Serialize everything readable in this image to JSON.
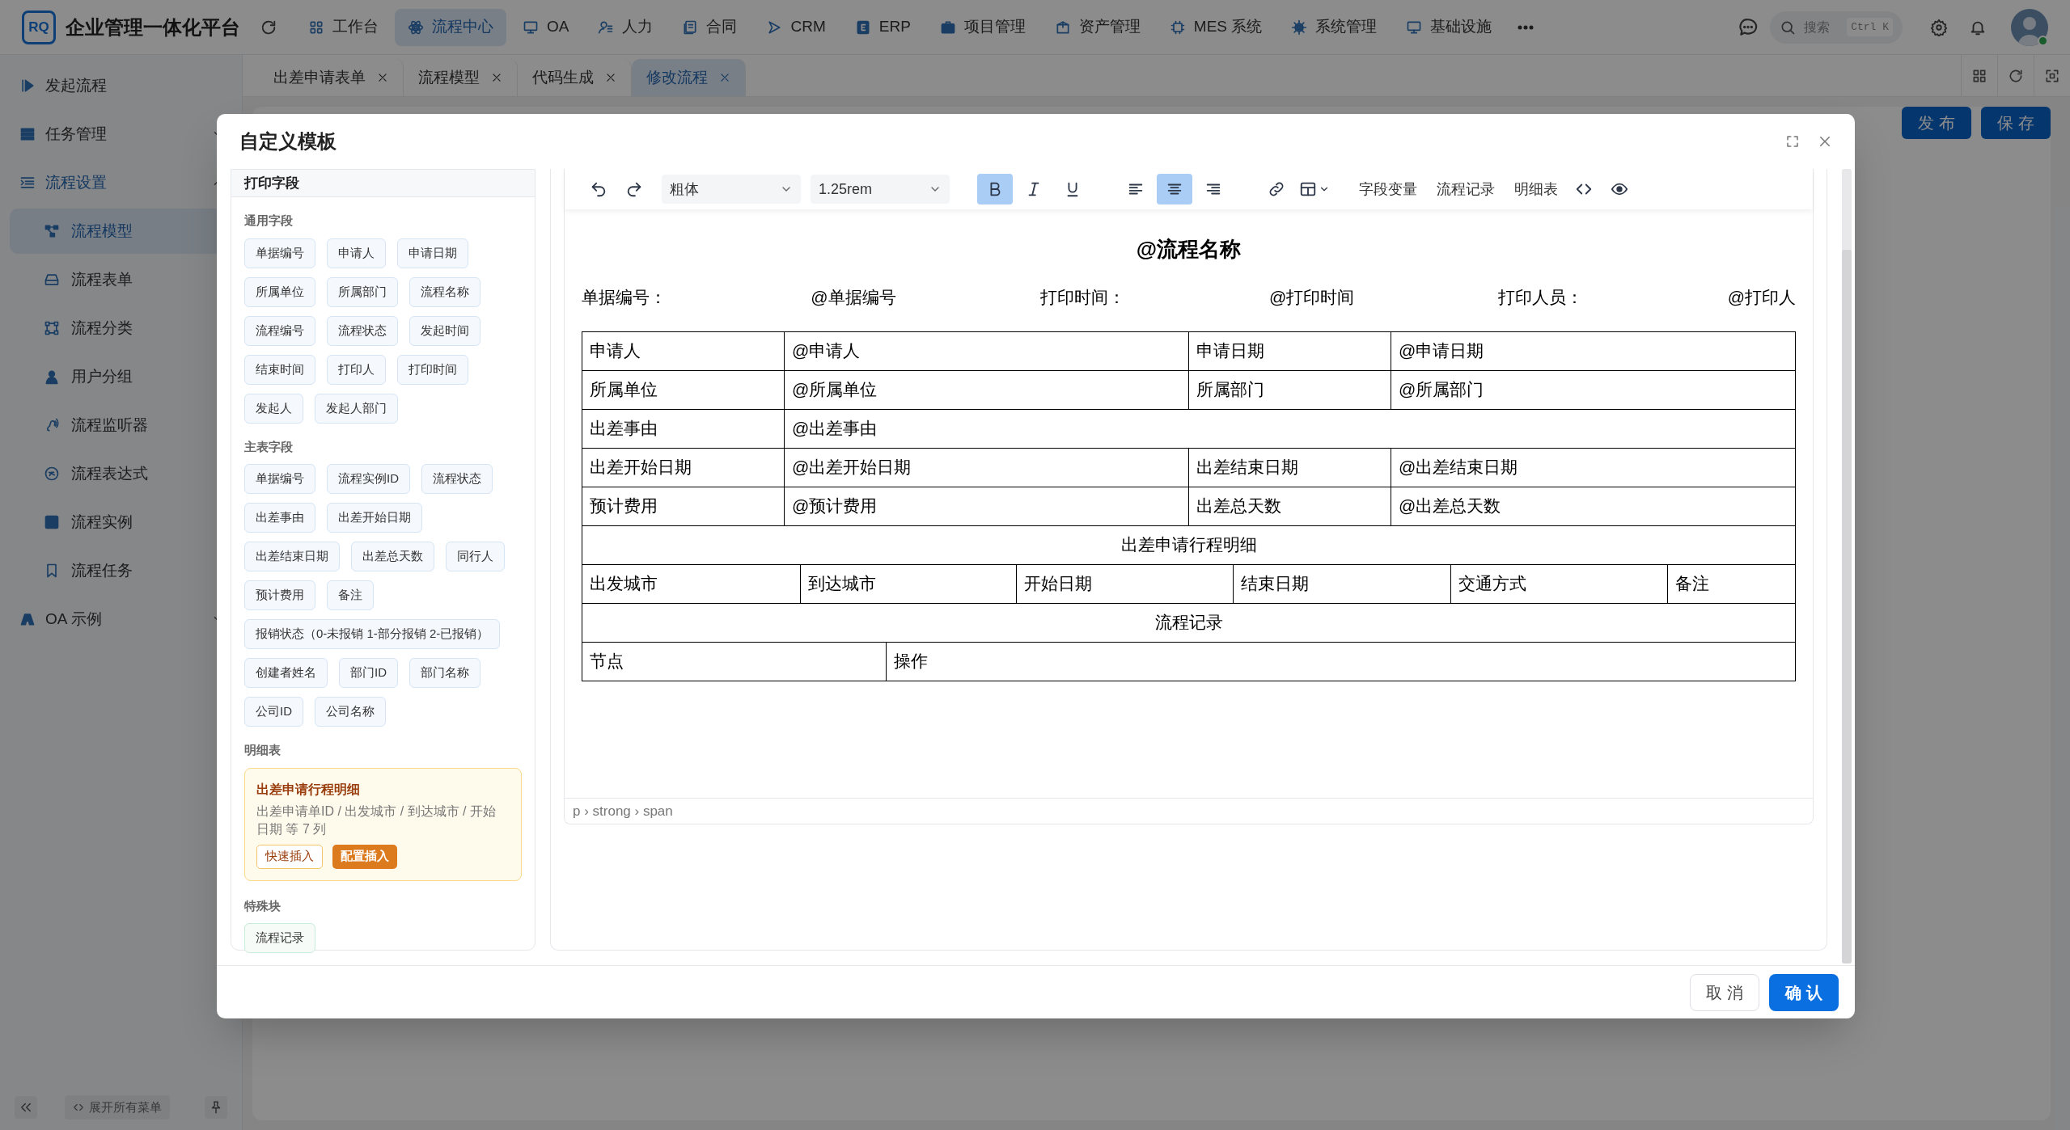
{
  "app": {
    "logo_text": "RQ",
    "title": "企业管理一体化平台"
  },
  "top_nav": [
    {
      "label": "工作台",
      "selected": false
    },
    {
      "label": "流程中心",
      "selected": true
    },
    {
      "label": "OA",
      "selected": false
    },
    {
      "label": "人力",
      "selected": false
    },
    {
      "label": "合同",
      "selected": false
    },
    {
      "label": "CRM",
      "selected": false
    },
    {
      "label": "ERP",
      "selected": false
    },
    {
      "label": "项目管理",
      "selected": false
    },
    {
      "label": "资产管理",
      "selected": false
    },
    {
      "label": "MES 系统",
      "selected": false
    },
    {
      "label": "系统管理",
      "selected": false
    },
    {
      "label": "基础设施",
      "selected": false
    }
  ],
  "search": {
    "placeholder": "搜索",
    "shortcut": "Ctrl K"
  },
  "sidebar": {
    "items": [
      {
        "label": "发起流程"
      },
      {
        "label": "任务管理",
        "expanded": false
      },
      {
        "label": "流程设置",
        "expanded": true,
        "children": [
          {
            "label": "流程模型",
            "selected": true
          },
          {
            "label": "流程表单",
            "selected": false
          },
          {
            "label": "流程分类",
            "selected": false
          },
          {
            "label": "用户分组",
            "selected": false
          },
          {
            "label": "流程监听器",
            "selected": false
          },
          {
            "label": "流程表达式",
            "selected": false
          },
          {
            "label": "流程实例",
            "selected": false
          },
          {
            "label": "流程任务",
            "selected": false
          }
        ]
      },
      {
        "label": "OA 示例",
        "expanded": false
      }
    ],
    "expand_all": "展开所有菜单"
  },
  "tabs": [
    {
      "label": "出差申请表单",
      "selected": false
    },
    {
      "label": "流程模型",
      "selected": false
    },
    {
      "label": "代码生成",
      "selected": false
    },
    {
      "label": "修改流程",
      "selected": true
    }
  ],
  "page_actions": [
    "发 布",
    "保 存"
  ],
  "dialog": {
    "title": "自定义模板",
    "fields_panel": {
      "title": "打印字段",
      "groups": [
        {
          "title": "通用字段",
          "kind": "fields",
          "items": [
            "单据编号",
            "申请人",
            "申请日期",
            "所属单位",
            "所属部门",
            "流程名称",
            "流程编号",
            "流程状态",
            "发起时间",
            "结束时间",
            "打印人",
            "打印时间",
            "发起人",
            "发起人部门"
          ]
        },
        {
          "title": "主表字段",
          "kind": "fields",
          "items": [
            "单据编号",
            "流程实例ID",
            "流程状态",
            "出差事由",
            "出差开始日期",
            "出差结束日期",
            "出差总天数",
            "同行人",
            "预计费用",
            "备注",
            "报销状态（0-未报销 1-部分报销 2-已报销）",
            "创建者姓名",
            "部门ID",
            "部门名称",
            "公司ID",
            "公司名称"
          ]
        },
        {
          "title": "明细表",
          "kind": "detail",
          "tables": [
            {
              "name": "出差申请行程明细",
              "summary": "出差申请单ID / 出发城市 / 到达城市 / 开始日期 等 7 列",
              "actions": [
                {
                  "label": "快速插入",
                  "kind": "outline"
                },
                {
                  "label": "配置插入",
                  "kind": "primary"
                }
              ]
            }
          ]
        },
        {
          "title": "特殊块",
          "kind": "special",
          "items": [
            "流程记录"
          ]
        }
      ]
    },
    "editor": {
      "toolbar": {
        "font": "粗体",
        "size": "1.25rem",
        "formats": [
          {
            "kind": "bold",
            "selected": true
          },
          {
            "kind": "italic",
            "selected": false
          },
          {
            "kind": "underline",
            "selected": false
          }
        ],
        "aligns": [
          {
            "kind": "left",
            "selected": false
          },
          {
            "kind": "center",
            "selected": true
          },
          {
            "kind": "right",
            "selected": false
          }
        ],
        "inserts": [
          "字段变量",
          "流程记录",
          "明细表"
        ]
      },
      "document": {
        "title": "@流程名称",
        "meta": [
          {
            "label": "单据编号：",
            "value": "@单据编号"
          },
          {
            "label": "打印时间：",
            "value": "@打印时间"
          },
          {
            "label": "打印人员：",
            "value": "@打印人"
          }
        ],
        "rows": [
          {
            "kind": "pair",
            "cells": [
              "申请人",
              "@申请人",
              "申请日期",
              "@申请日期"
            ]
          },
          {
            "kind": "pair",
            "cells": [
              "所属单位",
              "@所属单位",
              "所属部门",
              "@所属部门"
            ]
          },
          {
            "kind": "wide",
            "cells": [
              "出差事由",
              "@出差事由"
            ]
          },
          {
            "kind": "pair",
            "cells": [
              "出差开始日期",
              "@出差开始日期",
              "出差结束日期",
              "@出差结束日期"
            ]
          },
          {
            "kind": "pair",
            "cells": [
              "预计费用",
              "@预计费用",
              "出差总天数",
              "@出差总天数"
            ]
          },
          {
            "kind": "section",
            "cells": [
              "出差申请行程明细"
            ]
          },
          {
            "kind": "detail",
            "cells": [
              "出发城市",
              "到达城市",
              "开始日期",
              "结束日期",
              "交通方式",
              "备注"
            ]
          },
          {
            "kind": "section",
            "cells": [
              "流程记录"
            ]
          },
          {
            "kind": "record",
            "cells": [
              "节点",
              "操作"
            ]
          }
        ]
      },
      "status_path": "p › strong › span"
    },
    "buttons": [
      {
        "label": "取 消",
        "kind": "default"
      },
      {
        "label": "确 认",
        "kind": "primary"
      }
    ]
  }
}
